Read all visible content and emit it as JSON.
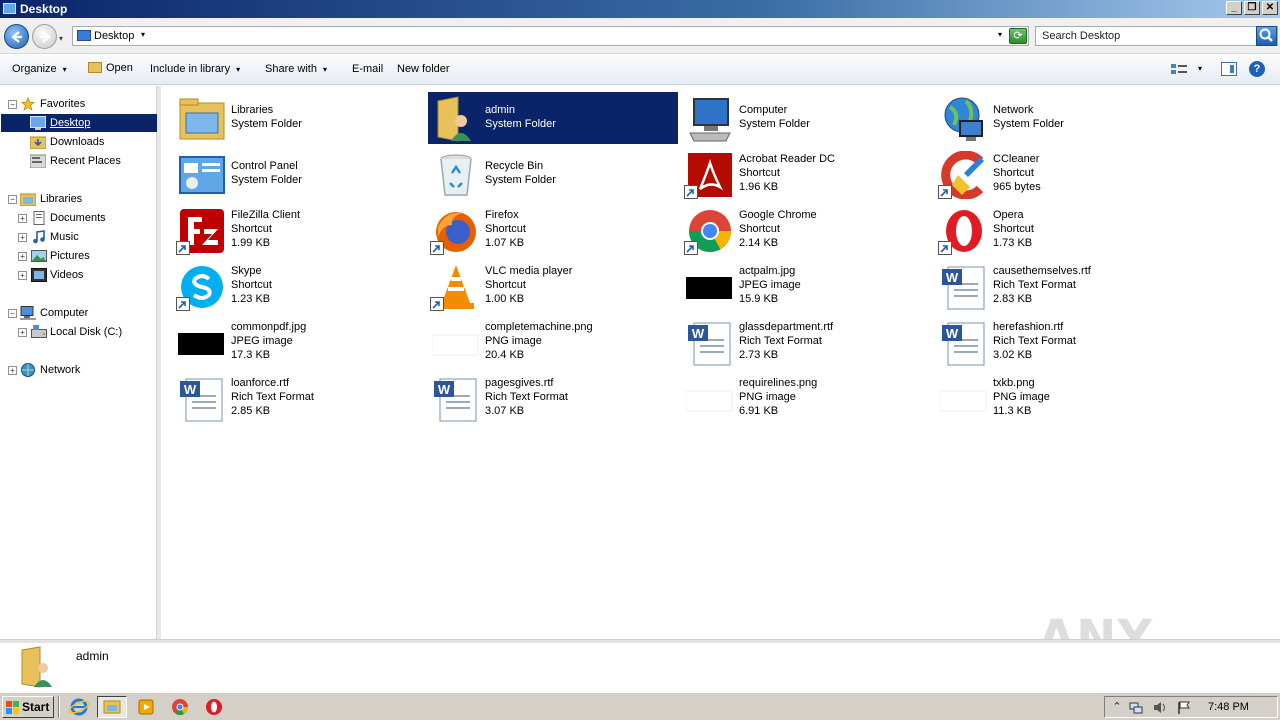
{
  "window": {
    "title": "Desktop"
  },
  "window_buttons": {
    "minimize": "_",
    "restore": "❐",
    "close": "✕"
  },
  "address": {
    "location": "Desktop",
    "caret": "▾",
    "right_caret": "▾",
    "refresh": "⟳"
  },
  "search": {
    "placeholder": "Search Desktop"
  },
  "commands": {
    "organize": "Organize",
    "open": "Open",
    "include_in_library": "Include in library",
    "share_with": "Share with",
    "email": "E-mail",
    "new_folder": "New folder",
    "caret": "▾",
    "help": "?"
  },
  "nav": {
    "favorites": "Favorites",
    "desktop": "Desktop",
    "downloads": "Downloads",
    "recent_places": "Recent Places",
    "libraries": "Libraries",
    "documents": "Documents",
    "music": "Music",
    "pictures": "Pictures",
    "videos": "Videos",
    "computer": "Computer",
    "local_disk": "Local Disk (C:)",
    "network": "Network",
    "collapse": "−",
    "expand": "+"
  },
  "items": [
    {
      "name": "Libraries",
      "type": "System Folder",
      "size": "",
      "icon": "libraries-icon"
    },
    {
      "name": "admin",
      "type": "System Folder",
      "size": "",
      "icon": "user-folder-icon"
    },
    {
      "name": "Computer",
      "type": "System Folder",
      "size": "",
      "icon": "computer-icon"
    },
    {
      "name": "Network",
      "type": "System Folder",
      "size": "",
      "icon": "network-icon"
    },
    {
      "name": "Control Panel",
      "type": "System Folder",
      "size": "",
      "icon": "control-panel-icon"
    },
    {
      "name": "Recycle Bin",
      "type": "System Folder",
      "size": "",
      "icon": "recycle-bin-icon"
    },
    {
      "name": "Acrobat Reader DC",
      "type": "Shortcut",
      "size": "1.96 KB",
      "icon": "acrobat-icon"
    },
    {
      "name": "CCleaner",
      "type": "Shortcut",
      "size": "965 bytes",
      "icon": "ccleaner-icon"
    },
    {
      "name": "FileZilla Client",
      "type": "Shortcut",
      "size": "1.99 KB",
      "icon": "filezilla-icon"
    },
    {
      "name": "Firefox",
      "type": "Shortcut",
      "size": "1.07 KB",
      "icon": "firefox-icon"
    },
    {
      "name": "Google Chrome",
      "type": "Shortcut",
      "size": "2.14 KB",
      "icon": "chrome-icon"
    },
    {
      "name": "Opera",
      "type": "Shortcut",
      "size": "1.73 KB",
      "icon": "opera-icon"
    },
    {
      "name": "Skype",
      "type": "Shortcut",
      "size": "1.23 KB",
      "icon": "skype-icon"
    },
    {
      "name": "VLC media player",
      "type": "Shortcut",
      "size": "1.00 KB",
      "icon": "vlc-icon"
    },
    {
      "name": "actpalm.jpg",
      "type": "JPEG image",
      "size": "15.9 KB",
      "icon": "jpeg-thumbnail-icon"
    },
    {
      "name": "causethemselves.rtf",
      "type": "Rich Text Format",
      "size": "2.83 KB",
      "icon": "rtf-icon"
    },
    {
      "name": "commonpdf.jpg",
      "type": "JPEG image",
      "size": "17.3 KB",
      "icon": "jpeg-thumbnail-icon"
    },
    {
      "name": "completemachine.png",
      "type": "PNG image",
      "size": "20.4 KB",
      "icon": "png-thumbnail-icon"
    },
    {
      "name": "glassdepartment.rtf",
      "type": "Rich Text Format",
      "size": "2.73 KB",
      "icon": "rtf-icon"
    },
    {
      "name": "herefashion.rtf",
      "type": "Rich Text Format",
      "size": "3.02 KB",
      "icon": "rtf-icon"
    },
    {
      "name": "loanforce.rtf",
      "type": "Rich Text Format",
      "size": "2.85 KB",
      "icon": "rtf-icon"
    },
    {
      "name": "pagesgives.rtf",
      "type": "Rich Text Format",
      "size": "3.07 KB",
      "icon": "rtf-icon"
    },
    {
      "name": "requirelines.png",
      "type": "PNG image",
      "size": "6.91 KB",
      "icon": "png-thumbnail-icon"
    },
    {
      "name": "txkb.png",
      "type": "PNG image",
      "size": "11.3 KB",
      "icon": "png-thumbnail-icon"
    }
  ],
  "selected_item": "admin",
  "details": {
    "name": "admin"
  },
  "watermark": "ANY RUN",
  "taskbar": {
    "start": "Start",
    "clock": "7:48 PM",
    "tray_expand": "⌃"
  },
  "colors": {
    "selection": "#0a246a",
    "title_gradient_start": "#0a246a",
    "taskbar": "#d4d0c8"
  }
}
